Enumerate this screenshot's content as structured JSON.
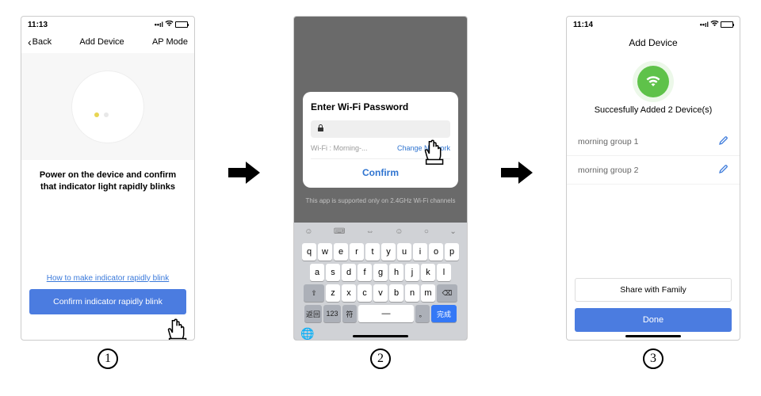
{
  "steps": {
    "one": "1",
    "two": "2",
    "three": "3"
  },
  "screen1": {
    "time": "11:13",
    "arrow_label": "‹",
    "back": "Back",
    "title": "Add Device",
    "ap_mode": "AP Mode",
    "instruction": "Power on the device and confirm that indicator light rapidly blinks",
    "help_link": "How to make indicator rapidly blink",
    "confirm_btn": "Confirm indicator rapidly blink"
  },
  "screen2": {
    "modal_title": "Enter Wi-Fi Password",
    "network_label": "Wi-Fi",
    "network_name": "Morning-...",
    "change_network": "Change Network",
    "confirm": "Confirm",
    "support_note": "This app is supported only on 2.4GHz Wi-Fi channels",
    "kbd_done": "完成",
    "kbd_left1": "返回",
    "kbd_left2": "123",
    "kbd_left3": "符"
  },
  "screen3": {
    "time": "11:14",
    "arrow_label": "‹",
    "title": "Add Device",
    "success": "Succesfully Added 2 Device(s)",
    "device1": "morning group 1",
    "device2": "morning group 2",
    "share": "Share with Family",
    "done": "Done"
  }
}
